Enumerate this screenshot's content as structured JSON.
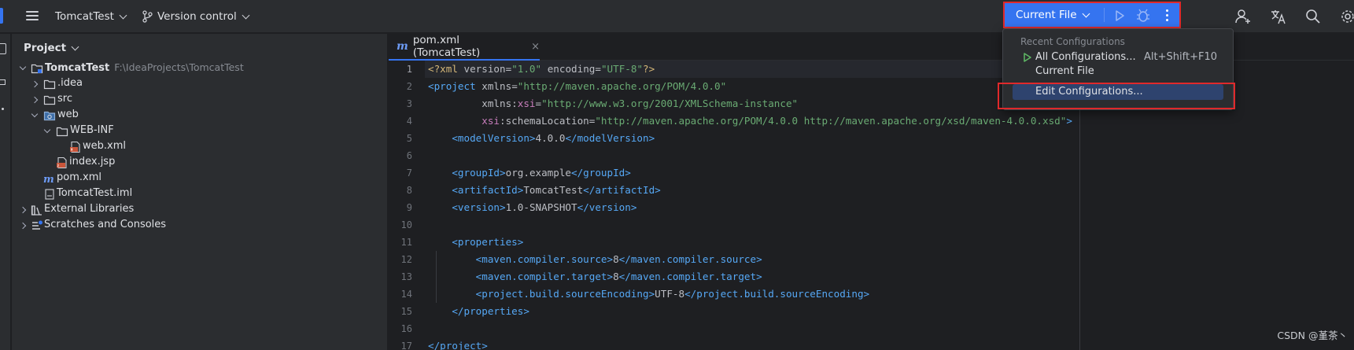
{
  "toolbar": {
    "project_name": "TomcatTest",
    "vcs_label": "Version control",
    "run_config": "Current File",
    "icons": [
      "main-menu-icon",
      "branch-icon",
      "run-icon",
      "debug-icon",
      "more-icon",
      "code-with-me-icon",
      "translate-icon",
      "search-icon",
      "settings-icon"
    ]
  },
  "project_panel": {
    "title": "Project",
    "tree": [
      {
        "label": "TomcatTest",
        "path": "F:\\IdeaProjects\\TomcatTest",
        "icon": "module-folder-icon",
        "expanded": true
      },
      {
        "label": ".idea",
        "icon": "folder-icon",
        "expanded": false
      },
      {
        "label": "src",
        "icon": "folder-icon",
        "expanded": false
      },
      {
        "label": "web",
        "icon": "web-folder-icon",
        "expanded": true
      },
      {
        "label": "WEB-INF",
        "icon": "folder-icon",
        "expanded": true
      },
      {
        "label": "web.xml",
        "icon": "xml-file-icon"
      },
      {
        "label": "index.jsp",
        "icon": "jsp-file-icon"
      },
      {
        "label": "pom.xml",
        "icon": "maven-file-icon"
      },
      {
        "label": "TomcatTest.iml",
        "icon": "iml-file-icon"
      },
      {
        "label": "External Libraries",
        "icon": "libraries-icon",
        "expanded": false
      },
      {
        "label": "Scratches and Consoles",
        "icon": "scratches-icon",
        "expanded": false
      }
    ]
  },
  "editor": {
    "tab_label": "pom.xml (TomcatTest)",
    "tab_close": "×",
    "line_numbers": [
      "1",
      "2",
      "3",
      "4",
      "5",
      "6",
      "7",
      "8",
      "9",
      "10",
      "11",
      "12",
      "13",
      "14",
      "15",
      "16",
      "17"
    ],
    "code_lines": [
      "<?xml version=\"1.0\" encoding=\"UTF-8\"?>",
      "<project xmlns=\"http://maven.apache.org/POM/4.0.0\"",
      "         xmlns:xsi=\"http://www.w3.org/2001/XMLSchema-instance\"",
      "         xsi:schemaLocation=\"http://maven.apache.org/POM/4.0.0 http://maven.apache.org/xsd/maven-4.0.0.xsd\">",
      "    <modelVersion>4.0.0</modelVersion>",
      "",
      "    <groupId>org.example</groupId>",
      "    <artifactId>TomcatTest</artifactId>",
      "    <version>1.0-SNAPSHOT</version>",
      "",
      "    <properties>",
      "        <maven.compiler.source>8</maven.compiler.source>",
      "        <maven.compiler.target>8</maven.compiler.target>",
      "        <project.build.sourceEncoding>UTF-8</project.build.sourceEncoding>",
      "    </properties>",
      "",
      "</project>"
    ]
  },
  "popup": {
    "header": "Recent Configurations",
    "items": [
      {
        "label": "All Configurations...",
        "shortcut": "Alt+Shift+F10"
      },
      {
        "label": "Current File",
        "shortcut": ""
      },
      {
        "label": "Edit Configurations...",
        "shortcut": ""
      }
    ]
  },
  "watermark": "CSDN @堇茶丶",
  "colors": {
    "accent": "#3574f0",
    "highlight_box": "#e0292b",
    "tag": "#56a8f5",
    "string": "#6aab73",
    "namespace": "#c77dbb"
  }
}
